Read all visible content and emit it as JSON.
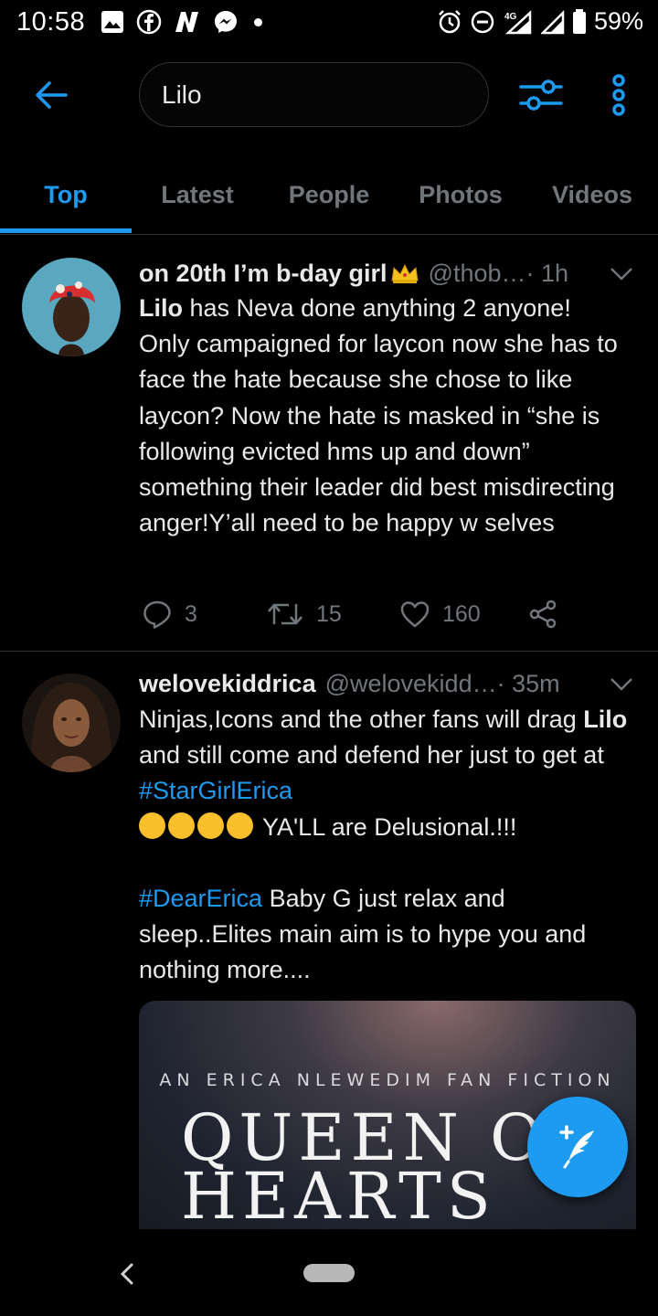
{
  "status_bar": {
    "time": "10:58",
    "battery": "59%",
    "network": "4G"
  },
  "search": {
    "query": "Lilo"
  },
  "tabs": [
    {
      "label": "Top",
      "active": true
    },
    {
      "label": "Latest",
      "active": false
    },
    {
      "label": "People",
      "active": false
    },
    {
      "label": "Photos",
      "active": false
    },
    {
      "label": "Videos",
      "active": false
    }
  ],
  "tweets": [
    {
      "name": "on 20th I’m b-day girl",
      "name_emoji": "crown-emoji",
      "handle": "@thob…",
      "time": " · 1h",
      "text_highlight": "Lilo",
      "text_rest": " has Neva done anything 2 anyone!\nOnly campaigned for laycon now she has to face the hate because she chose to like laycon? Now the hate is masked in “she is following evicted hms up and down” something their leader did best misdirecting anger!Y’all need to be happy w selves",
      "replies": "3",
      "retweets": "15",
      "likes": "160"
    },
    {
      "name": "welovekiddrica",
      "handle": "@welovekidd…",
      "time": " · 35m",
      "line1": "Ninjas,Icons and the other fans will drag ",
      "highlight": "Lilo",
      "line2": " and still come and defend her just to get at ",
      "hashtag1": "#StarGirlErica",
      "emoji_line": " YA'LL are Delusional.!!!",
      "hashtag2": "#DearErica",
      "line3": " Baby G just relax and sleep..Elites main aim is to hype you and nothing more....",
      "media_subtitle": "AN ERICA NLEWEDIM FAN FICTION",
      "media_title": "QUEEN O\nHEARTS"
    }
  ],
  "colors": {
    "accent": "#1d9bf0",
    "background": "#000000",
    "muted": "#71767b",
    "divider": "#2f3336"
  }
}
